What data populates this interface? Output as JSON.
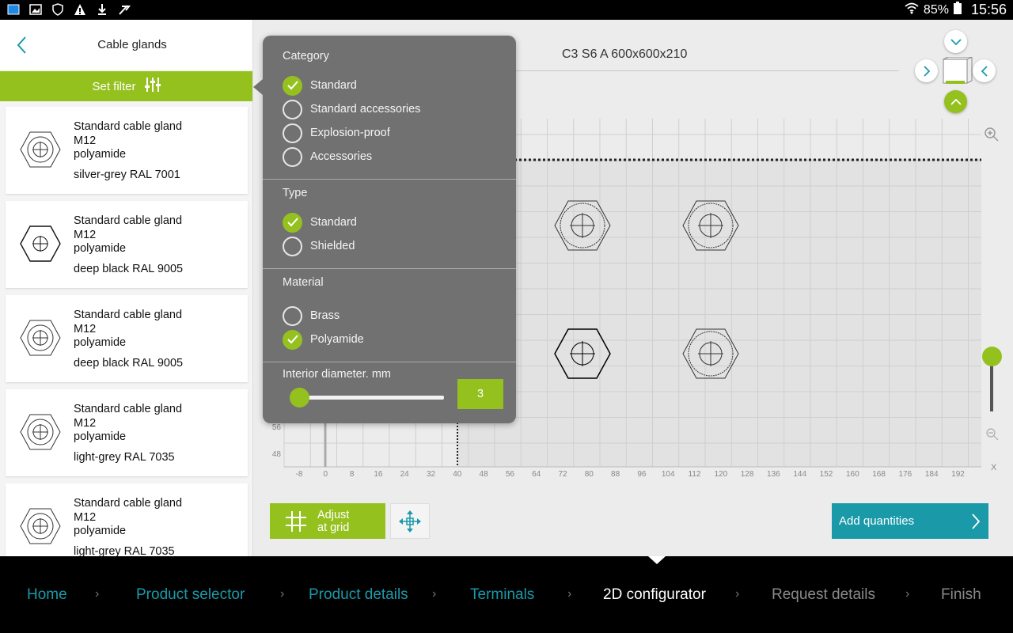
{
  "status_bar": {
    "battery": "85%",
    "time": "15:56"
  },
  "sidebar": {
    "title": "Cable glands",
    "filter_label": "Set filter",
    "products": [
      {
        "name": "Standard cable gland",
        "size": "M12",
        "material": "polyamide",
        "color": "silver-grey RAL 7001"
      },
      {
        "name": "Standard cable gland",
        "size": "M12",
        "material": "polyamide",
        "color": "deep black RAL 9005"
      },
      {
        "name": "Standard cable gland",
        "size": "M12",
        "material": "polyamide",
        "color": "deep black RAL 9005"
      },
      {
        "name": "Standard cable gland",
        "size": "M12",
        "material": "polyamide",
        "color": "light-grey RAL 7035"
      },
      {
        "name": "Standard cable gland",
        "size": "M12",
        "material": "polyamide",
        "color": "light-grey RAL 7035"
      }
    ]
  },
  "main": {
    "title": "C3 S6 A 600x600x210",
    "x_axis_label": "X",
    "x_ticks": [
      "-8",
      "0",
      "8",
      "16",
      "24",
      "32",
      "40",
      "48",
      "56",
      "64",
      "72",
      "80",
      "88",
      "96",
      "104",
      "112",
      "120",
      "128",
      "136",
      "144",
      "152",
      "160",
      "168",
      "176",
      "184",
      "192"
    ],
    "y_ticks": [
      "56",
      "48"
    ],
    "adjust_button": {
      "line1": "Adjust",
      "line2": "at grid"
    },
    "add_quantities": "Add quantities"
  },
  "filter_popup": {
    "category": {
      "title": "Category",
      "options": [
        {
          "label": "Standard",
          "checked": true
        },
        {
          "label": "Standard accessories",
          "checked": false
        },
        {
          "label": "Explosion-proof",
          "checked": false
        },
        {
          "label": "Accessories",
          "checked": false
        }
      ]
    },
    "type": {
      "title": "Type",
      "options": [
        {
          "label": "Standard",
          "checked": true
        },
        {
          "label": "Shielded",
          "checked": false
        }
      ]
    },
    "material": {
      "title": "Material",
      "options": [
        {
          "label": "Brass",
          "checked": false
        },
        {
          "label": "Polyamide",
          "checked": true
        }
      ]
    },
    "diameter": {
      "title": "Interior diameter. mm",
      "value": "3",
      "position": 0.0
    }
  },
  "breadcrumb": [
    {
      "label": "Home",
      "state": "done"
    },
    {
      "label": "Product selector",
      "state": "done"
    },
    {
      "label": "Product details",
      "state": "done"
    },
    {
      "label": "Terminals",
      "state": "done"
    },
    {
      "label": "2D configurator",
      "state": "active"
    },
    {
      "label": "Request details",
      "state": "todo"
    },
    {
      "label": "Finish",
      "state": "todo"
    }
  ],
  "colors": {
    "accent_green": "#95c11f",
    "accent_teal": "#1a9aa9",
    "popup_gray": "#717171"
  }
}
